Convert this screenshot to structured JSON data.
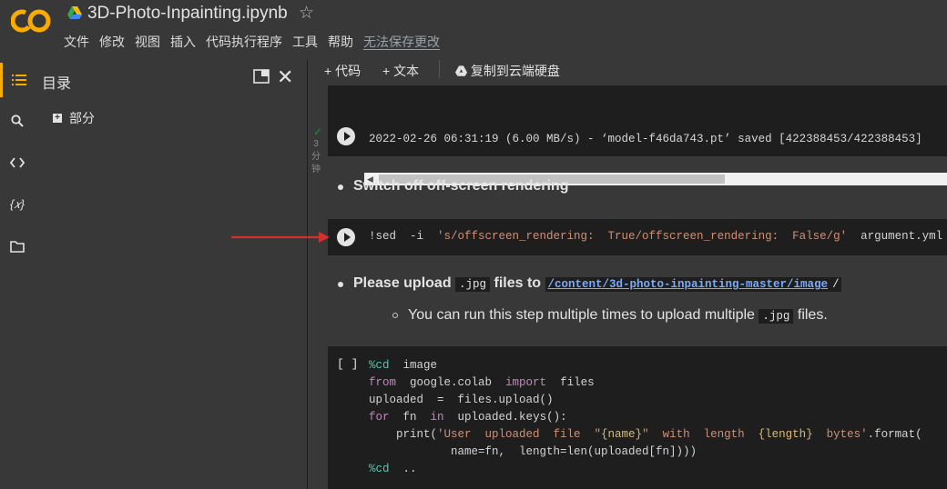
{
  "header": {
    "title": "3D-Photo-Inpainting.ipynb",
    "logo_text": "CO",
    "menu": [
      "文件",
      "修改",
      "视图",
      "插入",
      "代码执行程序",
      "工具",
      "帮助"
    ],
    "unsaved_label": "无法保存更改"
  },
  "toc": {
    "title": "目录",
    "section": "部分"
  },
  "toolbar": {
    "add_code": "+ 代码",
    "add_text": "+ 文本",
    "copy_drive": "复制到云端硬盘"
  },
  "cell1": {
    "output": "2022-02-26 06:31:19 (6.00 MB/s) - ‘model-f46da743.pt’ saved [422388453/422388453]",
    "status_time": "3",
    "status_unit_1": "分",
    "status_unit_2": "钟"
  },
  "md1": {
    "text": "Switch off off-screen rendering"
  },
  "cell2": {
    "cmd": "!sed  -i  ",
    "arg_string": "'s/offscreen_rendering:  True/offscreen_rendering:  False/g'",
    "file": "  argument.yml"
  },
  "md2": {
    "prefix": "Please upload ",
    "code": ".jpg",
    "middle": " files to ",
    "link": "/content/3d-photo-inpainting-master/image",
    "suffix": "/"
  },
  "md3": {
    "prefix": "You can run this step multiple times to upload multiple ",
    "code": ".jpg",
    "suffix": " files."
  },
  "cell3": {
    "bracket": "[ ]",
    "l1_magic": "%cd",
    "l1_rest": "  image",
    "l2_from": "from",
    "l2_mod": "  google.colab  ",
    "l2_import": "import",
    "l2_rest": "  files",
    "l3": "uploaded  =  files.upload()",
    "l4_for": "for",
    "l4_fn": "  fn  ",
    "l4_in": "in",
    "l4_rest": "  uploaded.keys():",
    "l5_pre": "    print(",
    "l5_str1": "'User  uploaded  file  \"",
    "l5_sub1": "{name}",
    "l5_str2": "\"  with  length  ",
    "l5_sub2": "{length}",
    "l5_str3": "  bytes'",
    "l5_post": ".format(",
    "l6": "            name=fn,  length=len(uploaded[fn])))",
    "l7_magic": "%cd",
    "l7_rest": "  .."
  }
}
